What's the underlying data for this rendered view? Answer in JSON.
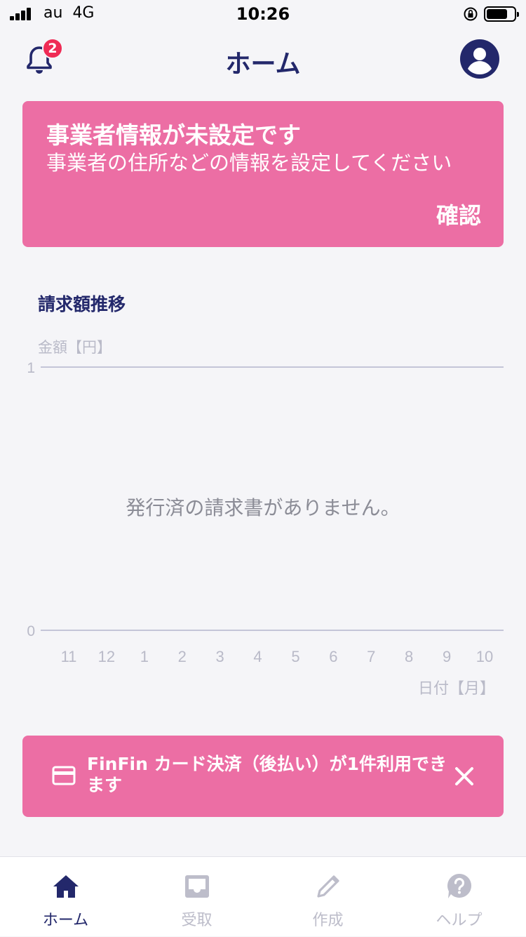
{
  "status_bar": {
    "carrier": "au",
    "network": "4G",
    "time": "10:26",
    "battery_level": 0.75
  },
  "header": {
    "title": "ホーム",
    "notification_count": "2",
    "bell_icon": "bell-icon",
    "account_icon": "account-circle-icon"
  },
  "alert": {
    "title": "事業者情報が未設定です",
    "body": "事業者の住所などの情報を設定してください",
    "action_label": "確認"
  },
  "chart_section": {
    "title": "請求額推移",
    "empty_message": "発行済の請求書がありません。"
  },
  "chart_data": {
    "type": "line",
    "ylabel": "金額【円】",
    "xlabel": "日付【月】",
    "categories": [
      "11",
      "12",
      "1",
      "2",
      "3",
      "4",
      "5",
      "6",
      "7",
      "8",
      "9",
      "10"
    ],
    "y_ticks": [
      "1",
      "0"
    ],
    "ylim": [
      0,
      1
    ],
    "series": [],
    "grid": "horizontal"
  },
  "promo": {
    "text": "FinFin カード決済（後払い）が1件利用できます",
    "card_icon": "credit-card-icon",
    "close_icon": "close-icon"
  },
  "tabs": [
    {
      "label": "ホーム",
      "icon": "home-icon",
      "active": true
    },
    {
      "label": "受取",
      "icon": "inbox-icon",
      "active": false
    },
    {
      "label": "作成",
      "icon": "pencil-icon",
      "active": false
    },
    {
      "label": "ヘルプ",
      "icon": "help-circle-icon",
      "active": false
    }
  ],
  "colors": {
    "accent": "#ec6ea4",
    "navy": "#23286b",
    "badge": "#ef2b55",
    "inactive": "#bdbdca"
  }
}
